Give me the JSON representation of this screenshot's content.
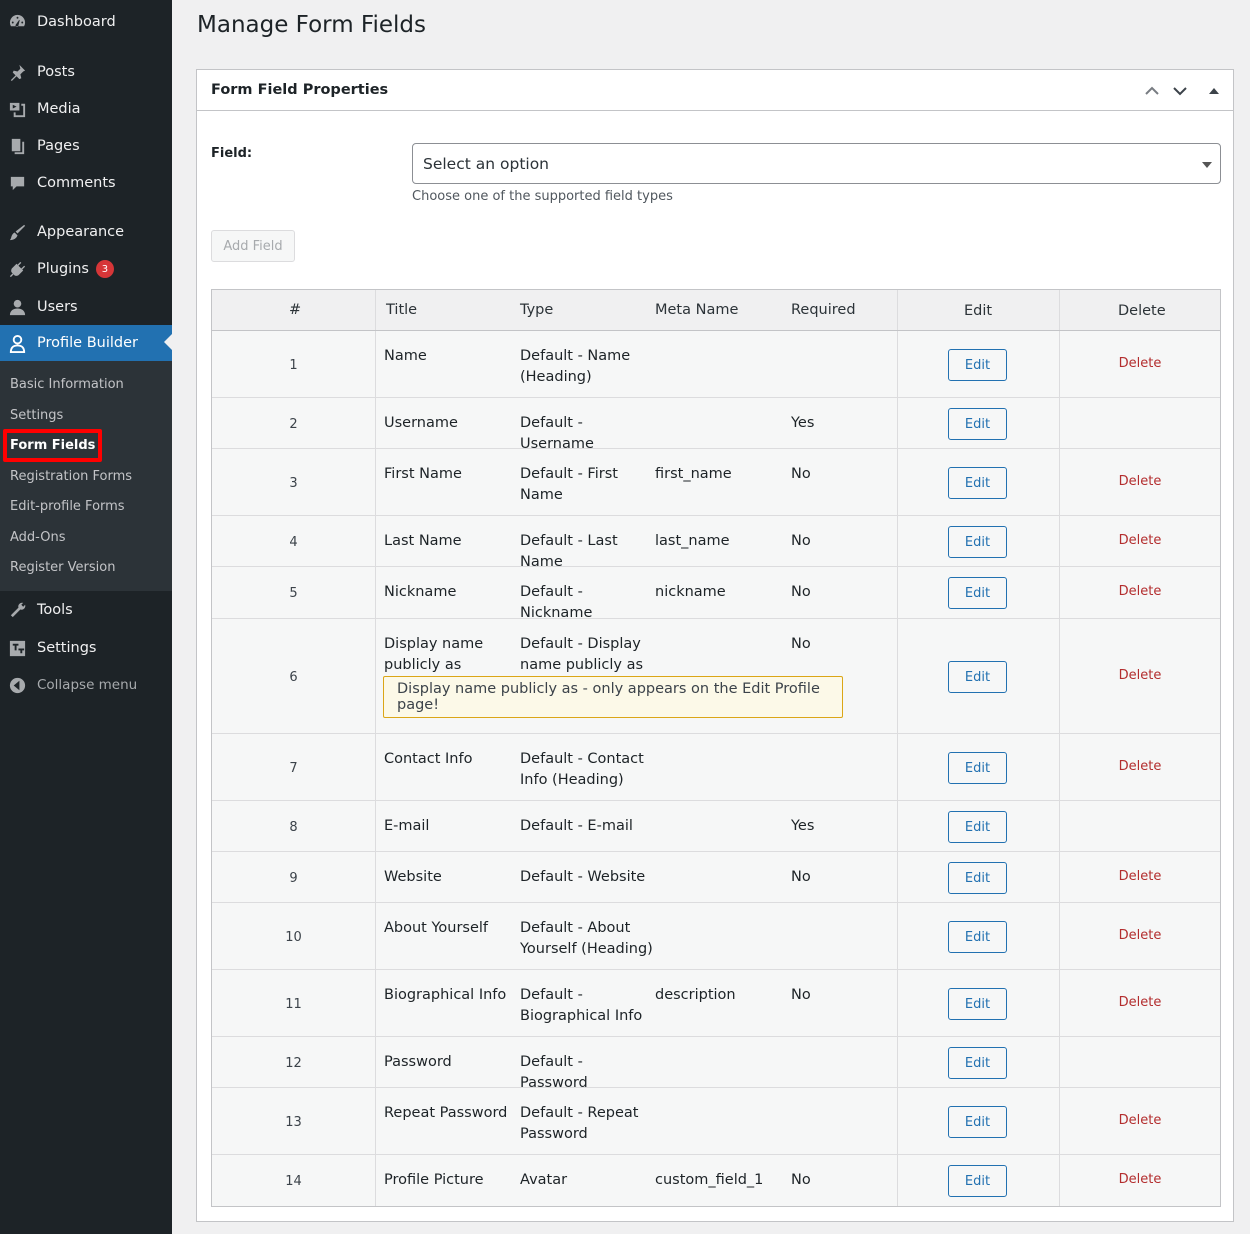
{
  "sidebar": {
    "items": [
      {
        "label": "Dashboard",
        "icon": "dashboard-icon"
      },
      {
        "label": "Posts",
        "icon": "pin-icon"
      },
      {
        "label": "Media",
        "icon": "media-icon"
      },
      {
        "label": "Pages",
        "icon": "pages-icon"
      },
      {
        "label": "Comments",
        "icon": "comments-icon"
      },
      {
        "label": "Appearance",
        "icon": "paintbrush-icon"
      },
      {
        "label": "Plugins",
        "icon": "plugin-icon",
        "badge": "3"
      },
      {
        "label": "Users",
        "icon": "users-icon"
      },
      {
        "label": "Profile Builder",
        "icon": "profile-icon"
      },
      {
        "label": "Tools",
        "icon": "wrench-icon"
      },
      {
        "label": "Settings",
        "icon": "settings-icon"
      },
      {
        "label": "Collapse menu",
        "icon": "collapse-icon"
      }
    ],
    "submenu": [
      "Basic Information",
      "Settings",
      "Form Fields",
      "Registration Forms",
      "Edit-profile Forms",
      "Add-Ons",
      "Register Version"
    ]
  },
  "page": {
    "title": "Manage Form Fields"
  },
  "panel": {
    "title": "Form Field Properties",
    "field_label": "Field:",
    "select_value": "Select an option",
    "select_description": "Choose one of the supported field types",
    "add_button": "Add Field"
  },
  "table": {
    "headers": [
      "#",
      "Title",
      "Type",
      "Meta Name",
      "Required",
      "Edit",
      "Delete"
    ],
    "edit_label": "Edit",
    "delete_label": "Delete",
    "notice": "Display name publicly as - only appears on the Edit Profile page!",
    "rows": [
      {
        "num": "1",
        "title": "Name",
        "type": "Default - Name (Heading)",
        "meta": "",
        "required": "",
        "delete": true
      },
      {
        "num": "2",
        "title": "Username",
        "type": "Default - Username",
        "meta": "",
        "required": "Yes",
        "delete": false
      },
      {
        "num": "3",
        "title": "First Name",
        "type": "Default - First Name",
        "meta": "first_name",
        "required": "No",
        "delete": true
      },
      {
        "num": "4",
        "title": "Last Name",
        "type": "Default - Last Name",
        "meta": "last_name",
        "required": "No",
        "delete": true
      },
      {
        "num": "5",
        "title": "Nickname",
        "type": "Default - Nickname",
        "meta": "nickname",
        "required": "No",
        "delete": true
      },
      {
        "num": "6",
        "title": "Display name publicly as",
        "type": "Default - Display name publicly as",
        "meta": "",
        "required": "No",
        "delete": true
      },
      {
        "num": "7",
        "title": "Contact Info",
        "type": "Default - Contact Info (Heading)",
        "meta": "",
        "required": "",
        "delete": true
      },
      {
        "num": "8",
        "title": "E-mail",
        "type": "Default - E-mail",
        "meta": "",
        "required": "Yes",
        "delete": false
      },
      {
        "num": "9",
        "title": "Website",
        "type": "Default - Website",
        "meta": "",
        "required": "No",
        "delete": true
      },
      {
        "num": "10",
        "title": "About Yourself",
        "type": "Default - About Yourself (Heading)",
        "meta": "",
        "required": "",
        "delete": true
      },
      {
        "num": "11",
        "title": "Biographical Info",
        "type": "Default - Biographical Info",
        "meta": "description",
        "required": "No",
        "delete": true
      },
      {
        "num": "12",
        "title": "Password",
        "type": "Default - Password",
        "meta": "",
        "required": "",
        "delete": false
      },
      {
        "num": "13",
        "title": "Repeat Password",
        "type": "Default - Repeat Password",
        "meta": "",
        "required": "",
        "delete": true
      },
      {
        "num": "14",
        "title": "Profile Picture",
        "type": "Avatar",
        "meta": "custom_field_1",
        "required": "No",
        "delete": true
      }
    ]
  },
  "colors": {
    "sidebar_bg": "#1d2327",
    "accent": "#2271b1",
    "delete": "#b32d2e",
    "badge": "#d63638",
    "notice_bg": "#fcf9e8",
    "notice_border": "#dba617",
    "highlight": "#ff0000"
  }
}
